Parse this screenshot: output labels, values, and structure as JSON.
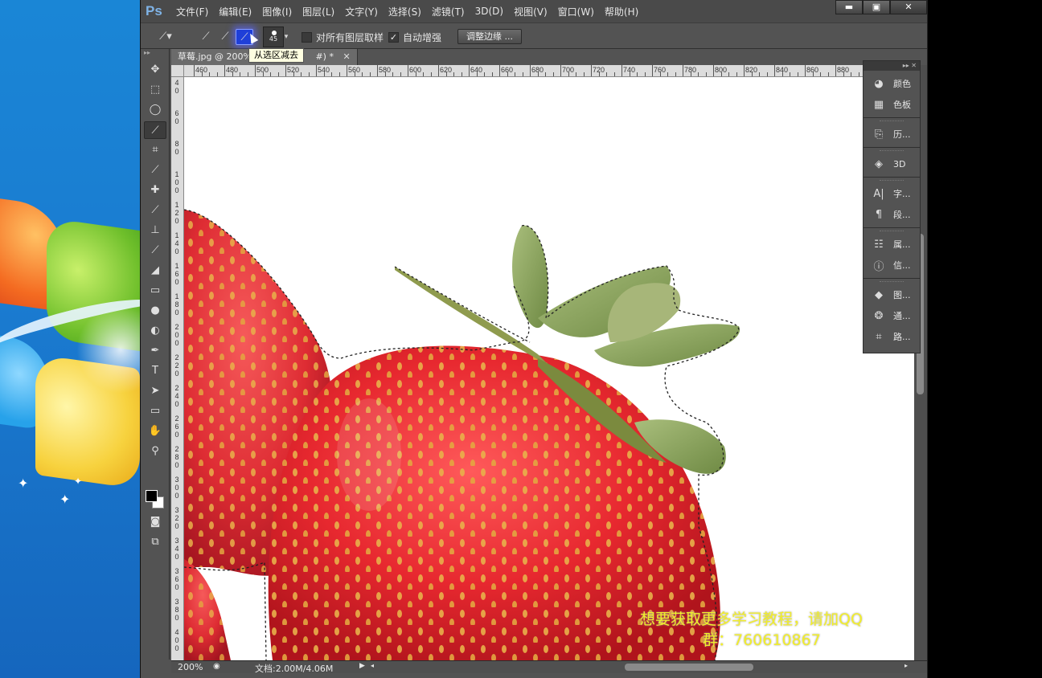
{
  "app": {
    "logo": "Ps"
  },
  "menu": [
    "文件(F)",
    "编辑(E)",
    "图像(I)",
    "图层(L)",
    "文字(Y)",
    "选择(S)",
    "滤镜(T)",
    "3D(D)",
    "视图(V)",
    "窗口(W)",
    "帮助(H)"
  ],
  "window_controls": {
    "minimize": "▬",
    "maximize": "▣",
    "close": "✕"
  },
  "options": {
    "brush_size": "45",
    "sample_all_layers_label": "对所有图层取样",
    "sample_all_layers_checked": false,
    "auto_enhance_label": "自动增强",
    "auto_enhance_checked": true,
    "refine_edge_label": "调整边缘 ...",
    "tooltip": "从选区减去"
  },
  "document": {
    "tab_title": "草莓.jpg @ 200%",
    "tab_suffix": "#) *",
    "zoom": "200%",
    "doc_info": "文档:2.00M/4.06M"
  },
  "ruler_top": [
    "460",
    "480",
    "500",
    "520",
    "540",
    "560",
    "580",
    "600",
    "620",
    "640",
    "660",
    "680",
    "700",
    "720",
    "740",
    "760",
    "780",
    "800",
    "820",
    "840",
    "860",
    "880"
  ],
  "ruler_left": [
    "4 0",
    "6 0",
    "8 0",
    "1 0 0",
    "1 2 0",
    "1 4 0",
    "1 6 0",
    "1 8 0",
    "2 0 0",
    "2 2 0",
    "2 4 0",
    "2 6 0",
    "2 8 0",
    "3 0 0",
    "3 2 0",
    "3 4 0",
    "3 6 0",
    "3 8 0",
    "4 0 0"
  ],
  "panels": [
    {
      "icon": "color-icon",
      "label": "颜色"
    },
    {
      "icon": "swatches-icon",
      "label": "色板"
    },
    {
      "icon": "history-icon",
      "label": "历..."
    },
    {
      "icon": "3d-icon",
      "label": "3D"
    },
    {
      "icon": "character-icon",
      "label": "字..."
    },
    {
      "icon": "paragraph-icon",
      "label": "段..."
    },
    {
      "icon": "properties-icon",
      "label": "属..."
    },
    {
      "icon": "info-icon",
      "label": "信..."
    },
    {
      "icon": "layers-icon",
      "label": "图..."
    },
    {
      "icon": "channels-icon",
      "label": "通..."
    },
    {
      "icon": "paths-icon",
      "label": "路..."
    }
  ],
  "watermark": {
    "line1": "想要获取更多学习教程，请加QQ",
    "line2": "群：760610867"
  },
  "colors": {
    "foreground": "#000000",
    "background": "#ffffff",
    "watermark": "#f2ee2a"
  }
}
